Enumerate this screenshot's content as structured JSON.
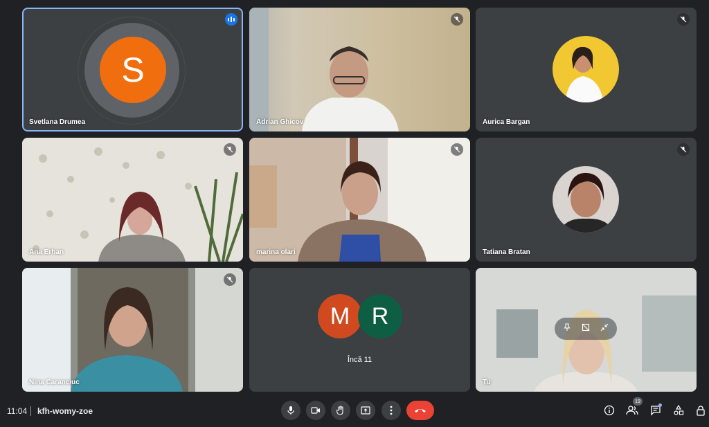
{
  "participants": [
    {
      "name": "Svetlana Drumea",
      "initial": "S",
      "avatar_color": "#f06e0d",
      "state": "speaking"
    },
    {
      "name": "Adrian Ghicov",
      "state": "muted"
    },
    {
      "name": "Aurica Bargan",
      "state": "muted"
    },
    {
      "name": "Ana Erhan",
      "state": "muted"
    },
    {
      "name": "marina olari",
      "state": "muted"
    },
    {
      "name": "Tatiana Bratan",
      "state": "muted"
    },
    {
      "name": "Nina Caranciuc",
      "state": "muted"
    }
  ],
  "more": {
    "initials": [
      "M",
      "R"
    ],
    "colors": [
      "#d14a1f",
      "#0d5e43"
    ],
    "label": "Încă 11"
  },
  "self": {
    "name": "Tu",
    "controls": [
      "pin-icon",
      "frame-off-icon",
      "minimize-icon"
    ]
  },
  "bottom_bar": {
    "time": "11:04",
    "meeting_code": "kfh-womy-zoe",
    "people_count": "19",
    "controls": [
      "mic-icon",
      "camera-icon",
      "raise-hand-icon",
      "present-icon",
      "more-options-icon",
      "end-call-icon"
    ],
    "right_icons": [
      "info-icon",
      "people-icon",
      "chat-icon",
      "activities-icon",
      "host-controls-icon"
    ]
  },
  "colors": {
    "background": "#202124",
    "tile": "#3c4043",
    "accent": "#8ab4f8",
    "end_call": "#ea4335"
  }
}
